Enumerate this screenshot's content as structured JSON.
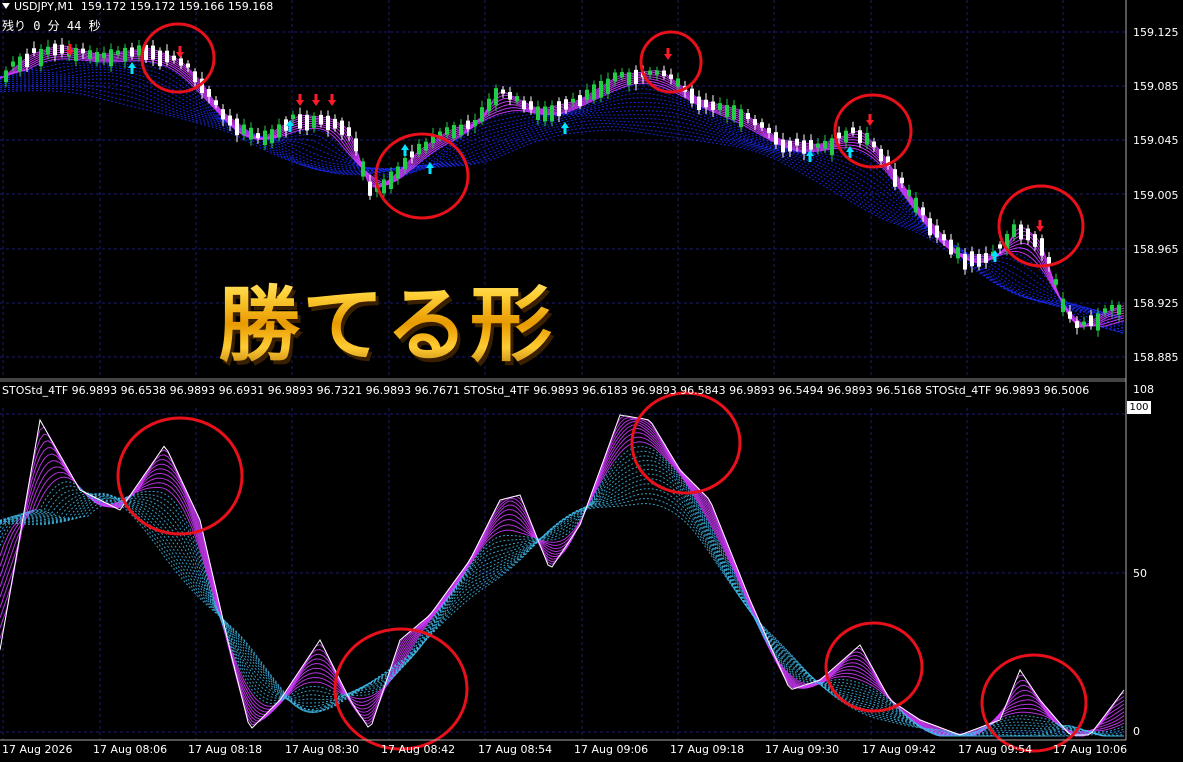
{
  "header": {
    "symbol": "USDJPY,M1",
    "ohlc": "159.172 159.172 159.166 159.168",
    "countdown": "残り 0 分 44 秒"
  },
  "headline": "勝てる形",
  "indicator": {
    "title": "STOStd_4TF 96.9893 96.6538 96.9893 96.6931 96.9893 96.7321 96.9893 96.7671  STOStd_4TF 96.9893 96.6183 96.9893 96.5843 96.9893 96.5494 96.9893 96.5168  STOStd_4TF 96.9893 96.5006",
    "scale_top": "108",
    "current_value": "100",
    "scale_mid": "50",
    "scale_bottom": "0"
  },
  "price_axis": [
    "159.125",
    "159.085",
    "159.045",
    "159.005",
    "158.965",
    "158.925",
    "158.885"
  ],
  "time_axis": [
    "17 Aug 2026",
    "17 Aug 08:06",
    "17 Aug 08:18",
    "17 Aug 08:30",
    "17 Aug 08:42",
    "17 Aug 08:54",
    "17 Aug 09:06",
    "17 Aug 09:18",
    "17 Aug 09:30",
    "17 Aug 09:42",
    "17 Aug 09:54",
    "17 Aug 10:06"
  ],
  "colors": {
    "background": "#000000",
    "grid": "#1b1b6e",
    "bull_candle": "#22cc44",
    "bear_candle": "#ffffff",
    "ribbon_blue": "#1a2cff",
    "ribbon_magenta": "#d23cff",
    "stoch_cyan": "#3fb7e8",
    "buy_arrow": "#00e5ff",
    "sell_arrow": "#ff1a2a",
    "highlight_circle": "#e8101a"
  }
}
